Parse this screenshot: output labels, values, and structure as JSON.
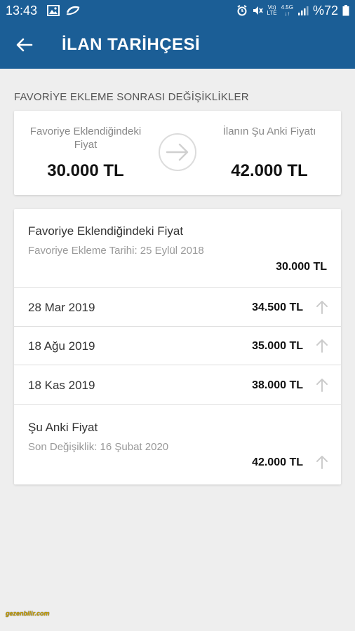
{
  "status_bar": {
    "time": "13:43",
    "icons_left": [
      "image-icon",
      "sync-icon"
    ],
    "icons_right": [
      "alarm-icon",
      "mute-icon",
      "volte-icon",
      "4g-icon",
      "signal-icon",
      "battery-icon"
    ],
    "volte_label": "Vo)\nLTE",
    "network_label": "4.5G",
    "battery_text": "%72"
  },
  "app_bar": {
    "title": "İLAN TARİHÇESİ",
    "back_icon": "arrow-left-icon"
  },
  "section": {
    "title": "FAVORİYE EKLEME SONRASI DEĞİŞİKLİKLER"
  },
  "summary": {
    "left_label": "Favoriye Eklendiğindeki Fiyat",
    "left_value": "30.000 TL",
    "right_label": "İlanın Şu Anki Fiyatı",
    "right_value": "42.000 TL",
    "arrow_icon": "arrow-right-icon"
  },
  "history": {
    "first": {
      "title": "Favoriye Eklendiğindeki Fiyat",
      "subtitle": "Favoriye Ekleme Tarihi: 25 Eylül 2018",
      "price": "30.000 TL"
    },
    "changes": [
      {
        "date": "28 Mar 2019",
        "price": "34.500 TL",
        "trend_icon": "arrow-up-icon"
      },
      {
        "date": "18 Ağu 2019",
        "price": "35.000 TL",
        "trend_icon": "arrow-up-icon"
      },
      {
        "date": "18 Kas 2019",
        "price": "38.000 TL",
        "trend_icon": "arrow-up-icon"
      }
    ],
    "last": {
      "title": "Şu Anki Fiyat",
      "subtitle": "Son Değişiklik: 16 Şubat 2020",
      "price": "42.000 TL",
      "trend_icon": "arrow-up-icon"
    }
  },
  "watermark": "gezenbilir.com",
  "colors": {
    "primary": "#1b5e96",
    "background": "#eeeeee",
    "card": "#ffffff",
    "trend_icon": "#cccccc"
  }
}
